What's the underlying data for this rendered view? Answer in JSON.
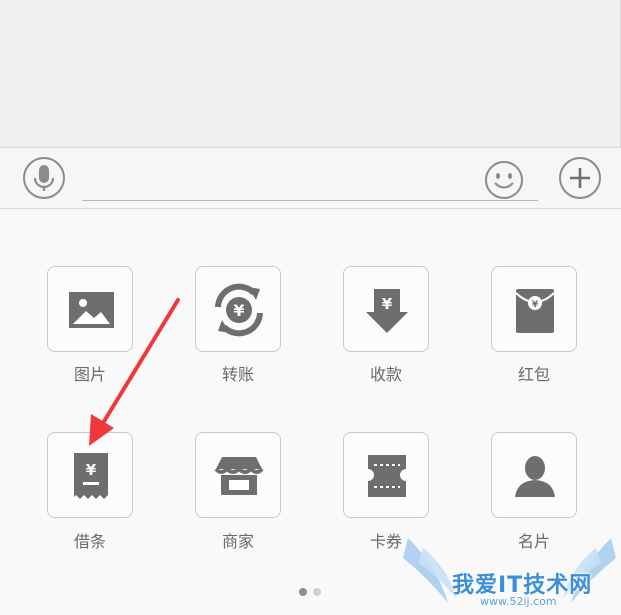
{
  "input_bar": {
    "voice_icon": "microphone-icon",
    "emoji_icon": "smiley-face-icon",
    "plus_icon": "plus-icon"
  },
  "tools": [
    {
      "label": "图片",
      "icon": "picture-icon"
    },
    {
      "label": "转账",
      "icon": "transfer-yuan-icon"
    },
    {
      "label": "收款",
      "icon": "receive-yuan-icon"
    },
    {
      "label": "红包",
      "icon": "red-envelope-icon"
    },
    {
      "label": "借条",
      "icon": "iou-receipt-icon"
    },
    {
      "label": "商家",
      "icon": "store-icon"
    },
    {
      "label": "卡券",
      "icon": "ticket-icon"
    },
    {
      "label": "名片",
      "icon": "contact-card-icon"
    }
  ],
  "pagination": {
    "pages": 2,
    "current": 1
  },
  "annotation": {
    "color": "#f0383a",
    "points_to": "借条"
  },
  "watermark": {
    "text": "我爱IT技术网",
    "url": "www.52ij.com"
  },
  "colors": {
    "icon": "#6e6e70",
    "tile_border": "#c9c9cb",
    "accent_arrow": "#f0383a"
  }
}
